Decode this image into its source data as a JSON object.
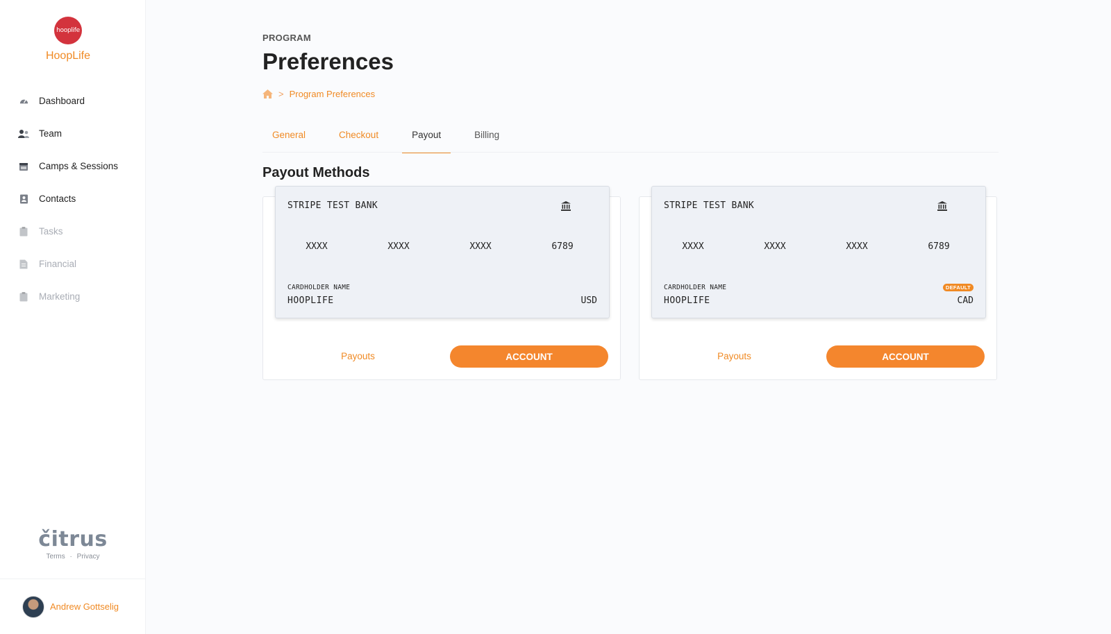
{
  "brand": {
    "logo_text": "hooplife",
    "name": "HoopLife"
  },
  "sidebar": {
    "items": [
      {
        "label": "Dashboard",
        "icon": "dashboard-gauge-icon"
      },
      {
        "label": "Team",
        "icon": "team-users-icon"
      },
      {
        "label": "Camps & Sessions",
        "icon": "calendar-icon"
      },
      {
        "label": "Contacts",
        "icon": "contacts-book-icon"
      },
      {
        "label": "Tasks",
        "icon": "clipboard-icon",
        "disabled": true
      },
      {
        "label": "Financial",
        "icon": "document-icon",
        "disabled": true
      },
      {
        "label": "Marketing",
        "icon": "clipboard-icon",
        "disabled": true
      }
    ],
    "footer_logo": "čitrus",
    "footer_links": {
      "terms": "Terms",
      "separator": "·",
      "privacy": "Privacy"
    },
    "user": {
      "name": "Andrew Gottselig"
    }
  },
  "header": {
    "eyebrow": "PROGRAM",
    "title": "Preferences",
    "breadcrumb": {
      "home_icon": "home-icon",
      "separator": ">",
      "current": "Program Preferences"
    }
  },
  "tabs": [
    {
      "label": "General"
    },
    {
      "label": "Checkout"
    },
    {
      "label": "Payout",
      "active": true
    },
    {
      "label": "Billing"
    }
  ],
  "section": {
    "title": "Payout Methods"
  },
  "payout_methods": [
    {
      "bank_name": "STRIPE TEST BANK",
      "bank_icon": "bank-icon",
      "digits": [
        "XXXX",
        "XXXX",
        "XXXX",
        "6789"
      ],
      "holder_label": "CARDHOLDER NAME",
      "holder_name": "HOOPLIFE",
      "currency": "USD",
      "payouts_label": "Payouts",
      "account_label": "ACCOUNT"
    },
    {
      "bank_name": "STRIPE TEST BANK",
      "bank_icon": "bank-icon",
      "digits": [
        "XXXX",
        "XXXX",
        "XXXX",
        "6789"
      ],
      "holder_label": "CARDHOLDER NAME",
      "holder_name": "HOOPLIFE",
      "currency": "CAD",
      "default_badge": "DEFAULT",
      "payouts_label": "Payouts",
      "account_label": "ACCOUNT"
    }
  ],
  "colors": {
    "accent": "#f08a24",
    "button": "#f4862d",
    "brand_logo": "#d3333d"
  }
}
